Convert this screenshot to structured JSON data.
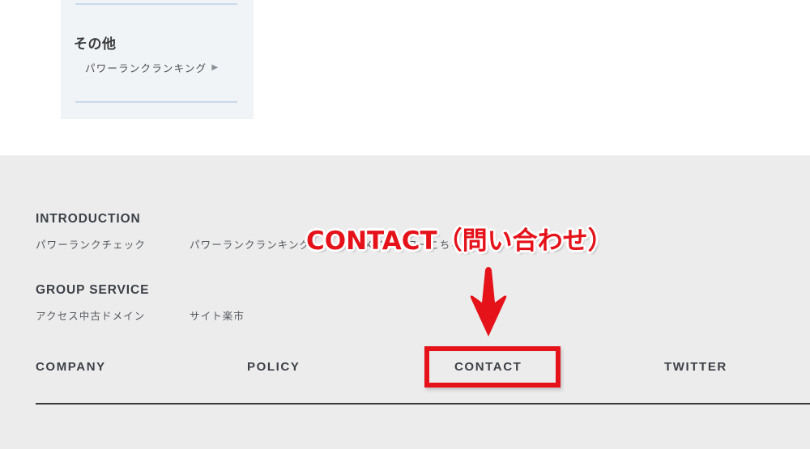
{
  "colors": {
    "page_background": "#ffffff",
    "footer_background": "#ececec",
    "sidebar_card_background": "#f1f4f7",
    "card_divider": "#c8d8ea",
    "heading_text": "#3c4148",
    "link_text": "#55595f",
    "annotation_red": "#e5121a",
    "rule": "#3b3b3b"
  },
  "sidebar_card": {
    "heading": "その他",
    "link": {
      "label": "パワーランクランキング",
      "arrow_icon": "triangle-right-icon",
      "arrow_glyph": "▶"
    }
  },
  "footer": {
    "groups": [
      {
        "title": "INTRODUCTION",
        "links": [
          "パワーランクチェック",
          "パワーランクランキング",
          "ドメインパワーこちら"
        ]
      },
      {
        "title": "GROUP SERVICE",
        "links": [
          "アクセス中古ドメイン",
          "サイト楽市"
        ]
      }
    ],
    "nav": [
      {
        "label": "COMPANY"
      },
      {
        "label": "POLICY"
      },
      {
        "label": "CONTACT"
      },
      {
        "label": "TWITTER"
      }
    ]
  },
  "annotation": {
    "text": "CONTACT（問い合わせ）",
    "arrow_icon": "arrow-down-icon",
    "highlight_target": "CONTACT"
  }
}
